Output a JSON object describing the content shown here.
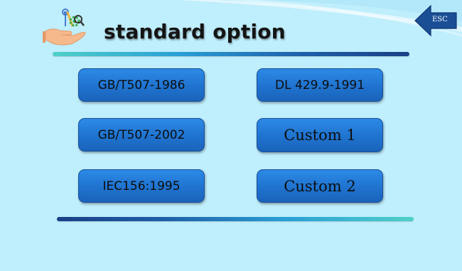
{
  "header": {
    "title": "standard option",
    "icon": "settings-tools-icon"
  },
  "esc_button": {
    "label": "ESC",
    "icon": "back-arrow-icon"
  },
  "options": [
    "GB/T507-1986",
    "DL 429.9-1991",
    "GB/T507-2002",
    "Custom 1",
    "IEC156:1995",
    "Custom 2"
  ],
  "colors": {
    "background": "#bfeefc",
    "button": "#1f73cf",
    "esc_arrow": "#1a4f96"
  }
}
